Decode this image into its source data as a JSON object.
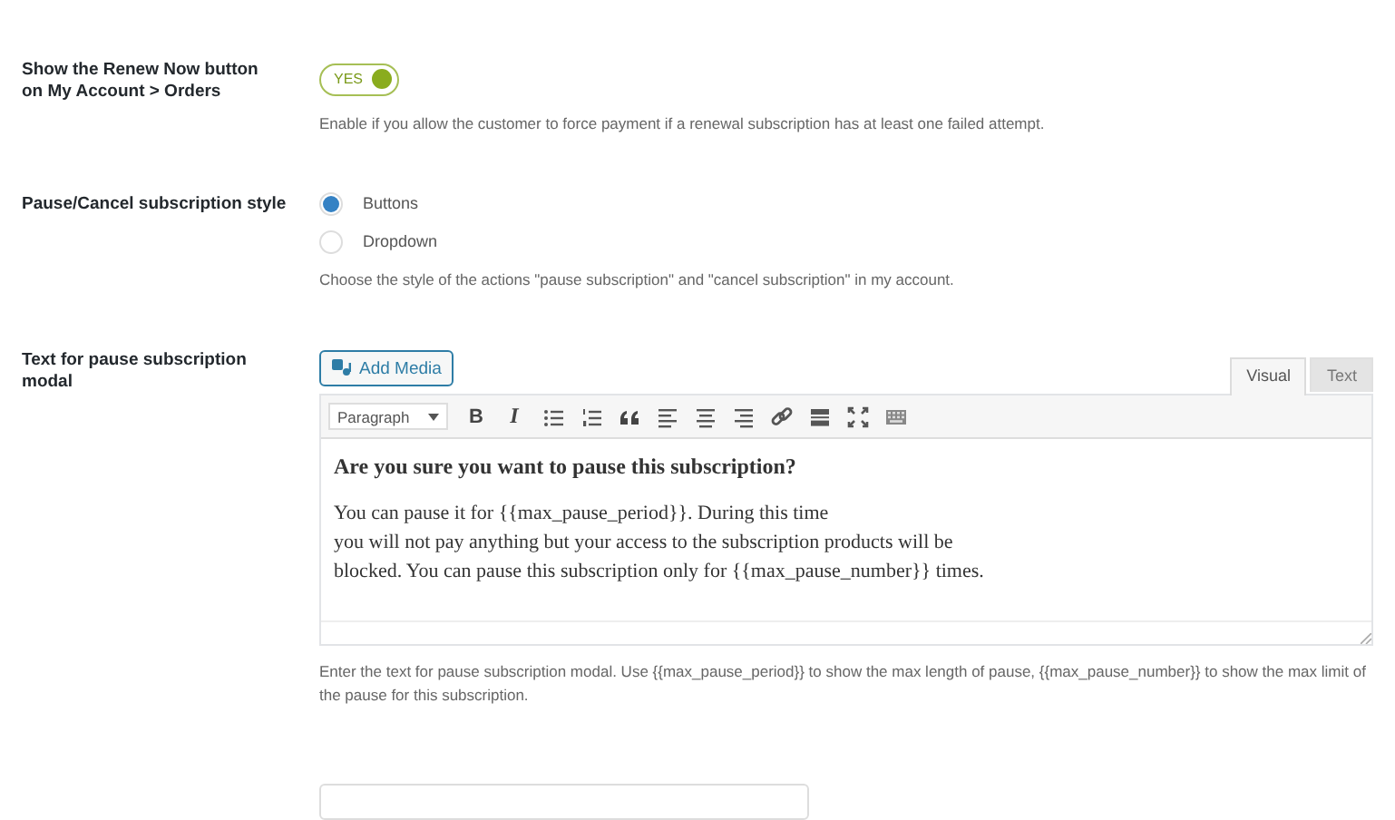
{
  "renew_now": {
    "label": "Show the Renew Now button on My Account > Orders",
    "toggle": {
      "text": "YES",
      "on": true
    },
    "description": "Enable if you allow the customer to force payment if a renewal subscription has at least one failed attempt."
  },
  "style": {
    "label": "Pause/Cancel subscription style",
    "options": [
      {
        "label": "Buttons",
        "selected": true
      },
      {
        "label": "Dropdown",
        "selected": false
      }
    ],
    "description": "Choose the style of the actions \"pause subscription\" and \"cancel subscription\" in my account."
  },
  "pause_text": {
    "label": "Text for pause subscription modal",
    "add_media": "Add Media",
    "tabs": [
      {
        "label": "Visual",
        "selected": true
      },
      {
        "label": "Text",
        "selected": false
      }
    ],
    "format": "Paragraph",
    "toolbar": [
      {
        "kind": "bold",
        "text": "B"
      },
      {
        "kind": "italic",
        "text": "I"
      },
      {
        "kind": "bullet-list"
      },
      {
        "kind": "numbered-list"
      },
      {
        "kind": "quote"
      },
      {
        "kind": "align-left"
      },
      {
        "kind": "align-center"
      },
      {
        "kind": "align-right"
      },
      {
        "kind": "link"
      },
      {
        "kind": "read-more"
      },
      {
        "kind": "fullscreen"
      },
      {
        "kind": "keyboard"
      }
    ],
    "heading": "Are you sure you want to pause this subscription?",
    "body_lines": [
      "You can pause it for {{max_pause_period}}. During this time",
      "you will not pay anything but your access to the subscription products will be",
      "blocked. You can pause this subscription only for {{max_pause_number}} times."
    ],
    "description": "Enter the text for pause subscription modal. Use {{max_pause_period}} to show the max length of pause, {{max_pause_number}} to show the max limit of the pause for this subscription."
  },
  "next_field": {
    "kind": "field"
  }
}
